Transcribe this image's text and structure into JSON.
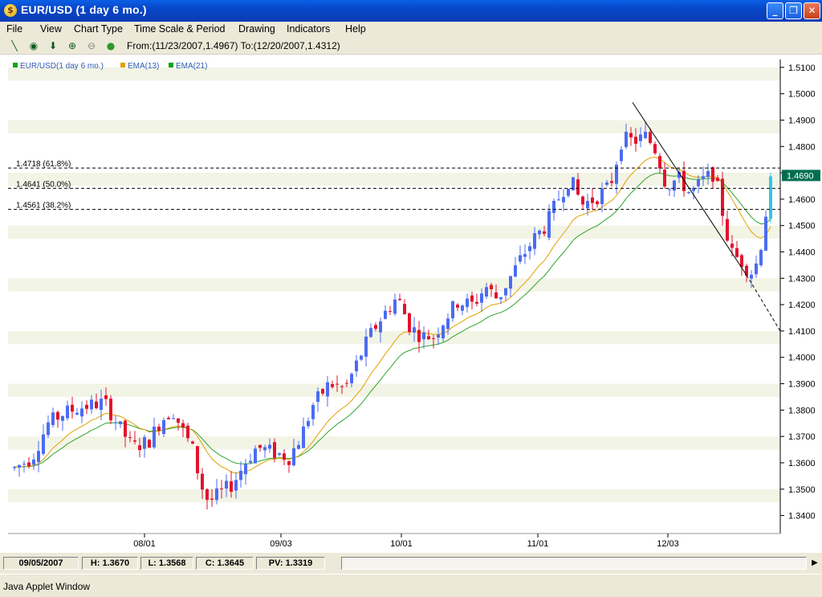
{
  "window": {
    "title": "EUR/USD (1 day  6 mo.)",
    "app_icon": "currency-icon",
    "minimize_icon": "minimize-icon",
    "maximize_icon": "restore-icon",
    "close_icon": "close-icon"
  },
  "menu": {
    "items": [
      "File",
      "View",
      "Chart Type",
      "Time Scale & Period",
      "Drawing",
      "Indicators",
      "Help"
    ]
  },
  "toolbar": {
    "icons": [
      "line-tool-icon",
      "crosshair-icon",
      "arrow-down-icon",
      "zoom-in-icon",
      "zoom-out-icon",
      "dot-icon"
    ],
    "range_text": "From:(11/23/2007,1.4967) To:(12/20/2007,1.4312)"
  },
  "chart_data": {
    "type": "candlestick",
    "colors": {
      "up": "#4B6CF2",
      "down": "#E3122C",
      "ema13": "#E0A000",
      "ema21": "#2FA42F",
      "price_tag": "#006E4E",
      "band": "#F2F4E6"
    },
    "legend": [
      {
        "label": "EUR/USD(1 day  6 mo.)",
        "color": "#13A513"
      },
      {
        "label": "EMA(13)",
        "color": "#E0A000"
      },
      {
        "label": "EMA(21)",
        "color": "#13A513"
      }
    ],
    "y_ticks": [
      "1.5100",
      "1.5000",
      "1.4900",
      "1.4800",
      "1.4700",
      "1.4600",
      "1.4500",
      "1.4400",
      "1.4300",
      "1.4200",
      "1.4100",
      "1.4000",
      "1.3900",
      "1.3800",
      "1.3700",
      "1.3600",
      "1.3500",
      "1.3400"
    ],
    "ylim": [
      1.335,
      1.513
    ],
    "x_ticks": [
      "08/01",
      "09/03",
      "10/01",
      "11/01",
      "12/03"
    ],
    "current_price": "1.4690",
    "fib_levels": [
      {
        "label": "1.4718 (61.8%)",
        "value": 1.4718
      },
      {
        "label": "1.4641 (50.0%)",
        "value": 1.4641
      },
      {
        "label": "1.4561 (38.2%)",
        "value": 1.4561
      }
    ],
    "trendline": {
      "from": [
        1.4967
      ],
      "to": [
        1.4312
      ]
    }
  },
  "status": {
    "date": "09/05/2007",
    "high": "H: 1.3670",
    "low": "L: 1.3568",
    "close": "C: 1.3645",
    "pv": "PV: 1.3319"
  },
  "applet_label": "Java Applet Window"
}
